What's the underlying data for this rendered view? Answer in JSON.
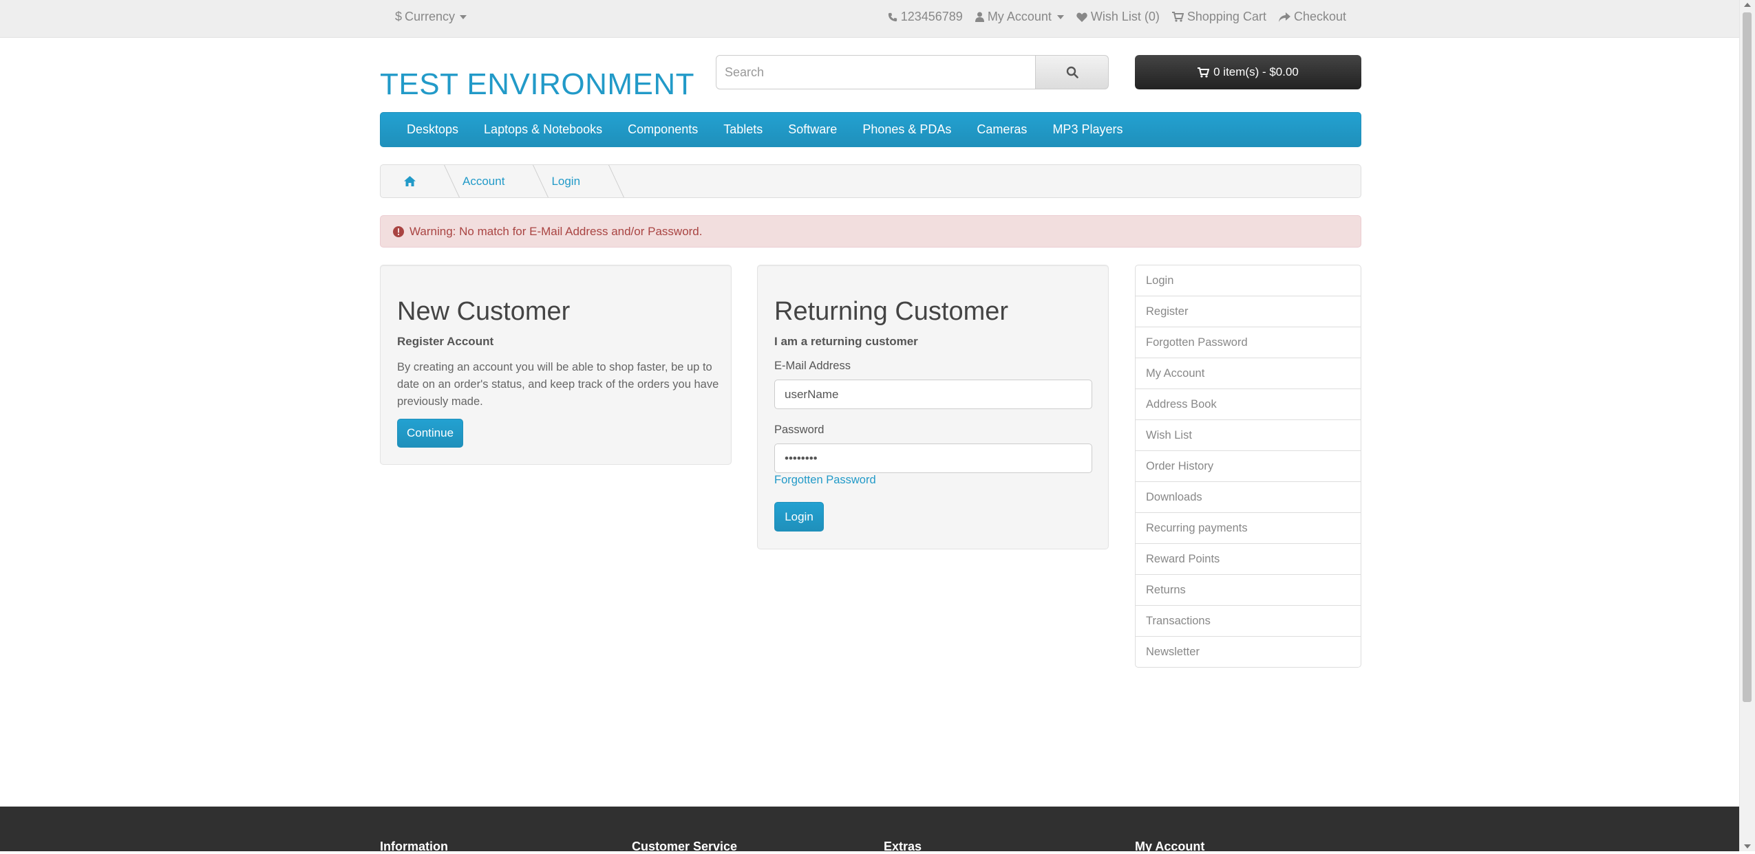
{
  "topbar": {
    "currency_symbol": "$",
    "currency_label": "Currency",
    "phone": "123456789",
    "my_account": "My Account",
    "wishlist": "Wish List (0)",
    "shopping_cart": "Shopping Cart",
    "checkout": "Checkout"
  },
  "header": {
    "logo": "TEST ENVIRONMENT",
    "search_placeholder": "Search",
    "cart_label": "0 item(s) - $0.00"
  },
  "menu": [
    "Desktops",
    "Laptops & Notebooks",
    "Components",
    "Tablets",
    "Software",
    "Phones & PDAs",
    "Cameras",
    "MP3 Players"
  ],
  "breadcrumb": [
    "Account",
    "Login"
  ],
  "alert": "Warning: No match for E-Mail Address and/or Password.",
  "new_customer": {
    "title": "New Customer",
    "subtitle": "Register Account",
    "text": "By creating an account you will be able to shop faster, be up to date on an order's status, and keep track of the orders you have previously made.",
    "button": "Continue"
  },
  "returning_customer": {
    "title": "Returning Customer",
    "subtitle": "I am a returning customer",
    "email_label": "E-Mail Address",
    "email_value": "userName",
    "password_label": "Password",
    "password_value": "••••••••",
    "forgotten": "Forgotten Password",
    "button": "Login"
  },
  "sidebar": [
    "Login",
    "Register",
    "Forgotten Password",
    "My Account",
    "Address Book",
    "Wish List",
    "Order History",
    "Downloads",
    "Recurring payments",
    "Reward Points",
    "Returns",
    "Transactions",
    "Newsletter"
  ],
  "footer": [
    "Information",
    "Customer Service",
    "Extras",
    "My Account"
  ],
  "colors": {
    "brand_blue": "#229ac8",
    "alert_bg": "#f2dede",
    "alert_text": "#a94442",
    "footer_bg": "#303030"
  }
}
